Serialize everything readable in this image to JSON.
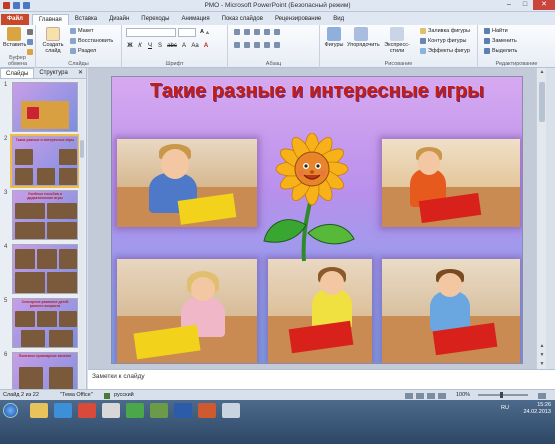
{
  "window": {
    "title": "РМО - Microsoft PowerPoint (Безопасный режим)",
    "minimize": "–",
    "maximize": "□",
    "close": "✕"
  },
  "ribbon_tabs": [
    "Файл",
    "Главная",
    "Вставка",
    "Дизайн",
    "Переходы",
    "Анимация",
    "Показ слайдов",
    "Рецензирование",
    "Вид"
  ],
  "ribbon": {
    "clipboard": {
      "paste": "Вставить",
      "label": "Буфер обмена"
    },
    "slides": {
      "new_slide": "Создать слайд",
      "layout": "Макет",
      "reset": "Восстановить",
      "section": "Раздел",
      "label": "Слайды"
    },
    "font": {
      "font_name": "",
      "font_size": "",
      "label": "Шрифт",
      "buttons": [
        "Ж",
        "К",
        "Ч",
        "S",
        "abc",
        "A",
        "Aa",
        "A"
      ]
    },
    "paragraph": {
      "label": "Абзац"
    },
    "drawing": {
      "shapes": "Фигуры",
      "arrange": "Упорядочить",
      "quick_styles": "Экспресс-стили",
      "fill": "Заливка фигуры",
      "outline": "Контур фигуры",
      "effects": "Эффекты фигур",
      "label": "Рисование"
    },
    "editing": {
      "find": "Найти",
      "replace": "Заменить",
      "select": "Выделить",
      "label": "Редактирование"
    }
  },
  "panel": {
    "tabs": [
      "Слайды",
      "Структура"
    ],
    "close": "✕",
    "thumbnails": [
      {
        "num": "1",
        "title": ""
      },
      {
        "num": "2",
        "title": "Такие разные и интересные игры"
      },
      {
        "num": "3",
        "title": "Учебные пособия и дидактические игры"
      },
      {
        "num": "4",
        "title": ""
      },
      {
        "num": "5",
        "title": "Сенсорное развитие детей раннего возраста"
      },
      {
        "num": "6",
        "title": "Полезное кулинарное занятие"
      }
    ]
  },
  "slide": {
    "title": "Такие разные и интересные игры"
  },
  "notes": {
    "placeholder": "Заметки к слайду"
  },
  "status": {
    "slide": "Слайд 2 из 22",
    "theme": "\"Тема Office\"",
    "language": "русский",
    "zoom": "100%"
  },
  "taskbar": {
    "lang": "RU",
    "time": "15:26",
    "date": "24.02.2013"
  },
  "colors": {
    "file_tab": "#c7482b",
    "title_red": "#c41e12",
    "selection": "#f2b94b"
  }
}
